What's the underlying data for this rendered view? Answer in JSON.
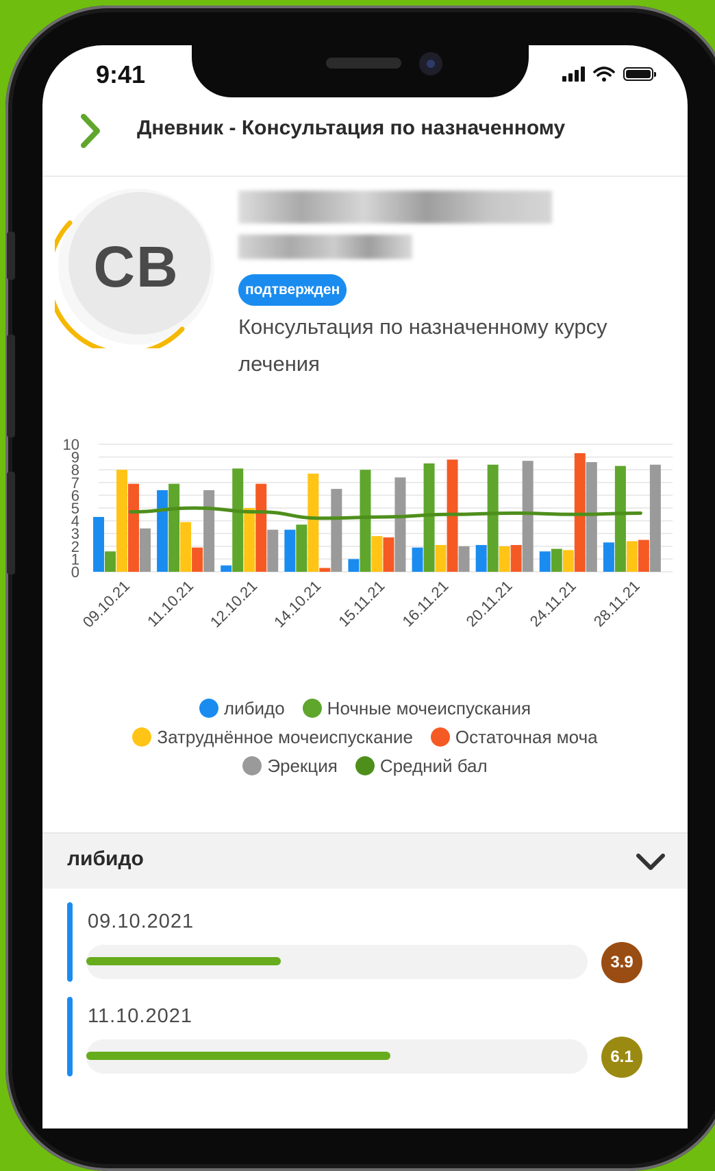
{
  "status_bar": {
    "time": "9:41"
  },
  "header": {
    "title": "Дневник - Консультация по назначенному"
  },
  "profile": {
    "initials": "CB",
    "badge": "подтвержден",
    "subtitle": "Консультация по назначенному курсу лечения"
  },
  "chart_data": {
    "type": "bar",
    "categories": [
      "09.10.21",
      "11.10.21",
      "12.10.21",
      "14.10.21",
      "15.11.21",
      "16.11.21",
      "20.11.21",
      "24.11.21",
      "28.11.21"
    ],
    "ylim": [
      0,
      10
    ],
    "yticks": [
      "0",
      "1",
      "2",
      "3",
      "4",
      "5",
      "6",
      "7",
      "8",
      "9",
      "10"
    ],
    "series": [
      {
        "name": "либидо",
        "color": "#1a8cf0",
        "values": [
          4.3,
          6.4,
          0.5,
          3.3,
          1.0,
          1.9,
          2.1,
          1.6,
          2.3
        ]
      },
      {
        "name": "Ночные мочеиспускания",
        "color": "#5fa62c",
        "values": [
          1.6,
          6.9,
          8.1,
          3.7,
          8.0,
          8.5,
          8.4,
          1.8,
          8.3
        ]
      },
      {
        "name": "Затруднённое мочеиспускание",
        "color": "#ffc416",
        "values": [
          8.0,
          3.9,
          5.0,
          7.7,
          2.8,
          2.1,
          2.0,
          1.7,
          2.4
        ]
      },
      {
        "name": "Остаточная моча",
        "color": "#f55a24",
        "values": [
          6.9,
          1.9,
          6.9,
          0.3,
          2.7,
          8.8,
          2.1,
          9.3,
          2.5
        ]
      },
      {
        "name": "Эрекция",
        "color": "#9a9a9a",
        "values": [
          3.4,
          6.4,
          3.3,
          6.5,
          7.4,
          2.0,
          8.7,
          8.6,
          8.4
        ]
      },
      {
        "name": "Средний бал",
        "color": "#4e8f1c",
        "type": "line",
        "values": [
          4.7,
          5.0,
          4.7,
          4.2,
          4.3,
          4.5,
          4.6,
          4.5,
          4.6
        ]
      }
    ]
  },
  "section": {
    "title": "либидо"
  },
  "entries": [
    {
      "date": "09.10.2021",
      "score": "3.9",
      "fraction": 0.39,
      "score_color": "#9a4d12"
    },
    {
      "date": "11.10.2021",
      "score": "6.1",
      "fraction": 0.61,
      "score_color": "#9b8a12"
    }
  ],
  "icons": {
    "back": "chevron-right-icon",
    "expand": "chevron-down-icon"
  }
}
